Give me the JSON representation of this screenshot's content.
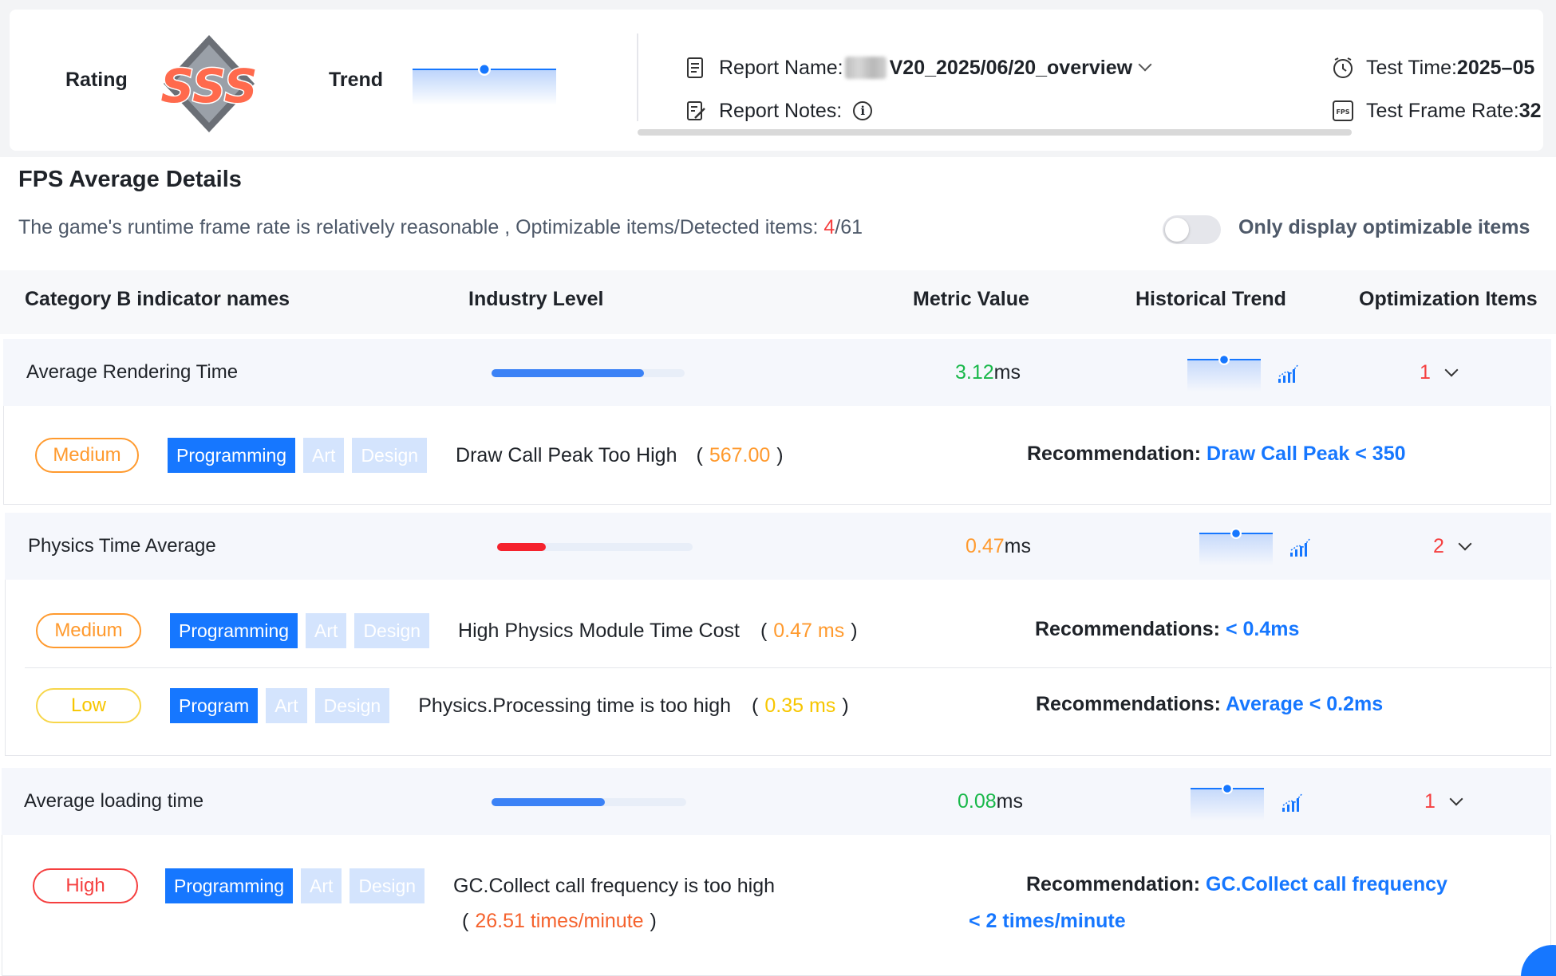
{
  "header": {
    "rating_label": "Rating",
    "rating_value": "SSS",
    "trend_label": "Trend",
    "report_name_label": "Report Name:",
    "report_name_value": "V20_2025/06/20_overview",
    "report_notes_label": "Report Notes:",
    "test_time_label": "Test Time:",
    "test_time_value": "2025–05",
    "frame_rate_label": "Test Frame Rate:",
    "frame_rate_value": "32"
  },
  "details": {
    "title": "FPS Average Details",
    "summary_text": "The game's runtime frame rate is relatively reasonable , Optimizable items/Detected items: ",
    "optimizable_count": "4",
    "detected_count": "/61",
    "toggle_label": "Only display optimizable items",
    "toggle_on": false
  },
  "table": {
    "columns": [
      "Category B indicator names",
      "Industry Level",
      "Metric Value",
      "Historical Trend",
      "Optimization Items"
    ]
  },
  "metrics": [
    {
      "name": "Average Rendering Time",
      "level_fraction": 0.79,
      "level_color": "#3b82f6",
      "value": "3.12",
      "unit": "ms",
      "value_color": "#19b84a",
      "opt_count": "1",
      "issues": [
        {
          "severity": "Medium",
          "tags": [
            "Programming",
            "Art",
            "Design"
          ],
          "issue": "Draw Call Peak Too High",
          "measure": "567.00",
          "rec_label": "Recommendation:",
          "rec_value": "Draw Call Peak < 350"
        }
      ]
    },
    {
      "name": "Physics Time Average",
      "level_fraction": 0.25,
      "level_color": "#f5222d",
      "value": "0.47",
      "unit": "ms",
      "value_color": "#ff9a2e",
      "opt_count": "2",
      "issues": [
        {
          "severity": "Medium",
          "tags": [
            "Programming",
            "Art",
            "Design"
          ],
          "issue": "High Physics Module Time Cost",
          "measure": "0.47 ms",
          "rec_label": "Recommendations:",
          "rec_value": "< 0.4ms"
        },
        {
          "severity": "Low",
          "tags": [
            "Program",
            "Art",
            "Design"
          ],
          "issue": "Physics.Processing time is too high",
          "measure": "0.35 ms",
          "rec_label": "Recommendations:",
          "rec_value": "Average < 0.2ms"
        }
      ]
    },
    {
      "name": "Average loading time",
      "level_fraction": 0.58,
      "level_color": "#3b82f6",
      "value": "0.08",
      "unit": "ms",
      "value_color": "#19b84a",
      "opt_count": "1",
      "issues": [
        {
          "severity": "High",
          "tags": [
            "Programming",
            "Art",
            "Design"
          ],
          "issue": "GC.Collect call frequency is too high",
          "measure": "26.51 times/minute",
          "rec_label": "Recommendation:",
          "rec_value": "GC.Collect call frequency",
          "rec_value_2": "< 2 times/minute"
        }
      ]
    }
  ]
}
